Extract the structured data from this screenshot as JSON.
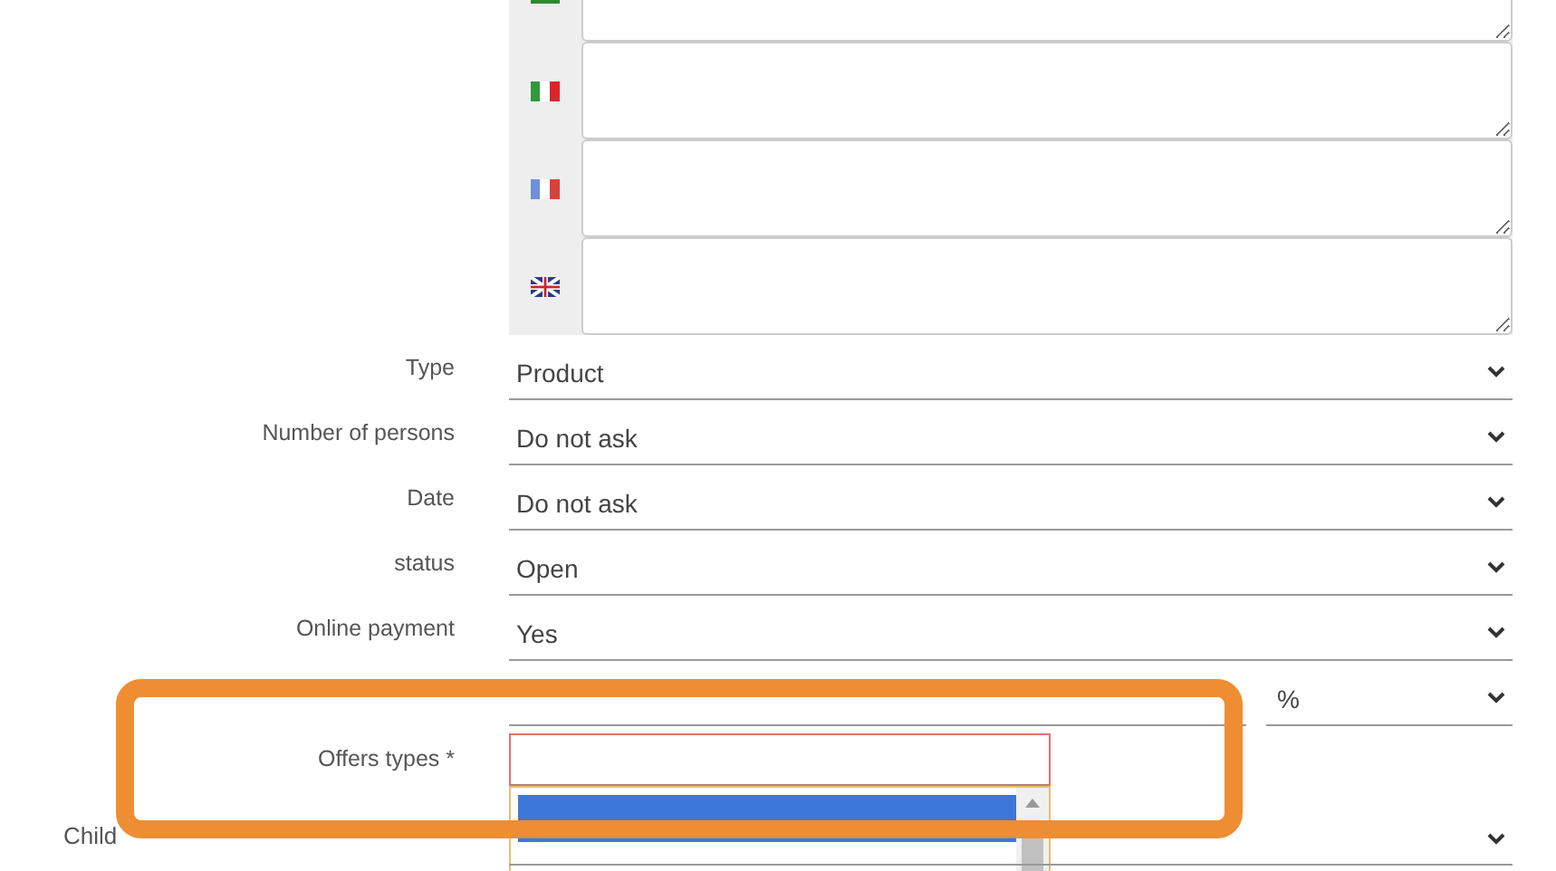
{
  "translations": [
    {
      "kind": "green"
    },
    {
      "kind": "italy"
    },
    {
      "kind": "france"
    },
    {
      "kind": "uk"
    }
  ],
  "fields": [
    {
      "label": "Type",
      "value": "Product"
    },
    {
      "label": "Number of persons",
      "value": "Do not ask"
    },
    {
      "label": "Date",
      "value": "Do not ask"
    },
    {
      "label": "status",
      "value": "Open"
    },
    {
      "label": "Online payment",
      "value": "Yes"
    }
  ],
  "amount": {
    "unit": "%"
  },
  "offers": {
    "label": "Offers types *",
    "invalid": true,
    "options": [
      {
        "selected": true
      }
    ]
  },
  "child": {
    "label": "Child"
  }
}
